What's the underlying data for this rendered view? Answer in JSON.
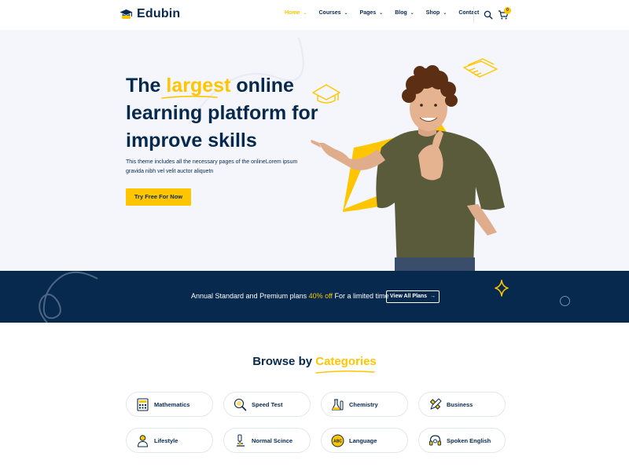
{
  "brand": {
    "name": "Edubin",
    "accent": "#ffc600",
    "navy": "#07294d"
  },
  "nav": {
    "items": [
      {
        "label": "Home",
        "dropdown": true,
        "active": true
      },
      {
        "label": "Courses",
        "dropdown": true
      },
      {
        "label": "Pages",
        "dropdown": true
      },
      {
        "label": "Blog",
        "dropdown": true
      },
      {
        "label": "Shop",
        "dropdown": true
      },
      {
        "label": "Contact",
        "dropdown": false
      }
    ],
    "search_icon": "search-icon",
    "cart_icon": "cart-icon",
    "cart_count": "0"
  },
  "hero": {
    "title_part1": "The ",
    "title_highlight": "largest",
    "title_part2": " online learning platform for improve skills",
    "description": "This theme includes all the necessary pages of the onlineLorem ipsum gravida nibh vel velit auctor aliquetn",
    "cta_label": "Try Free For Now"
  },
  "promo": {
    "text_before": "Annual Standard and Premium plans ",
    "text_highlight": "40% off",
    "text_after": " For a limited time",
    "button_label": "View All Plans",
    "button_icon": "arrow-right-icon"
  },
  "categories": {
    "title_part1": "Browse by ",
    "title_highlight": "Categories",
    "items": [
      {
        "label": "Mathematics",
        "icon": "calculator-icon"
      },
      {
        "label": "Speed Test",
        "icon": "magnifier-icon"
      },
      {
        "label": "Chemistry",
        "icon": "flask-icon"
      },
      {
        "label": "Business",
        "icon": "pencil-ruler-icon"
      },
      {
        "label": "Lifestyle",
        "icon": "person-icon"
      },
      {
        "label": "Normal Scince",
        "icon": "microscope-icon"
      },
      {
        "label": "Language",
        "icon": "abc-icon"
      },
      {
        "label": "Spoken English",
        "icon": "headphones-icon"
      }
    ]
  }
}
